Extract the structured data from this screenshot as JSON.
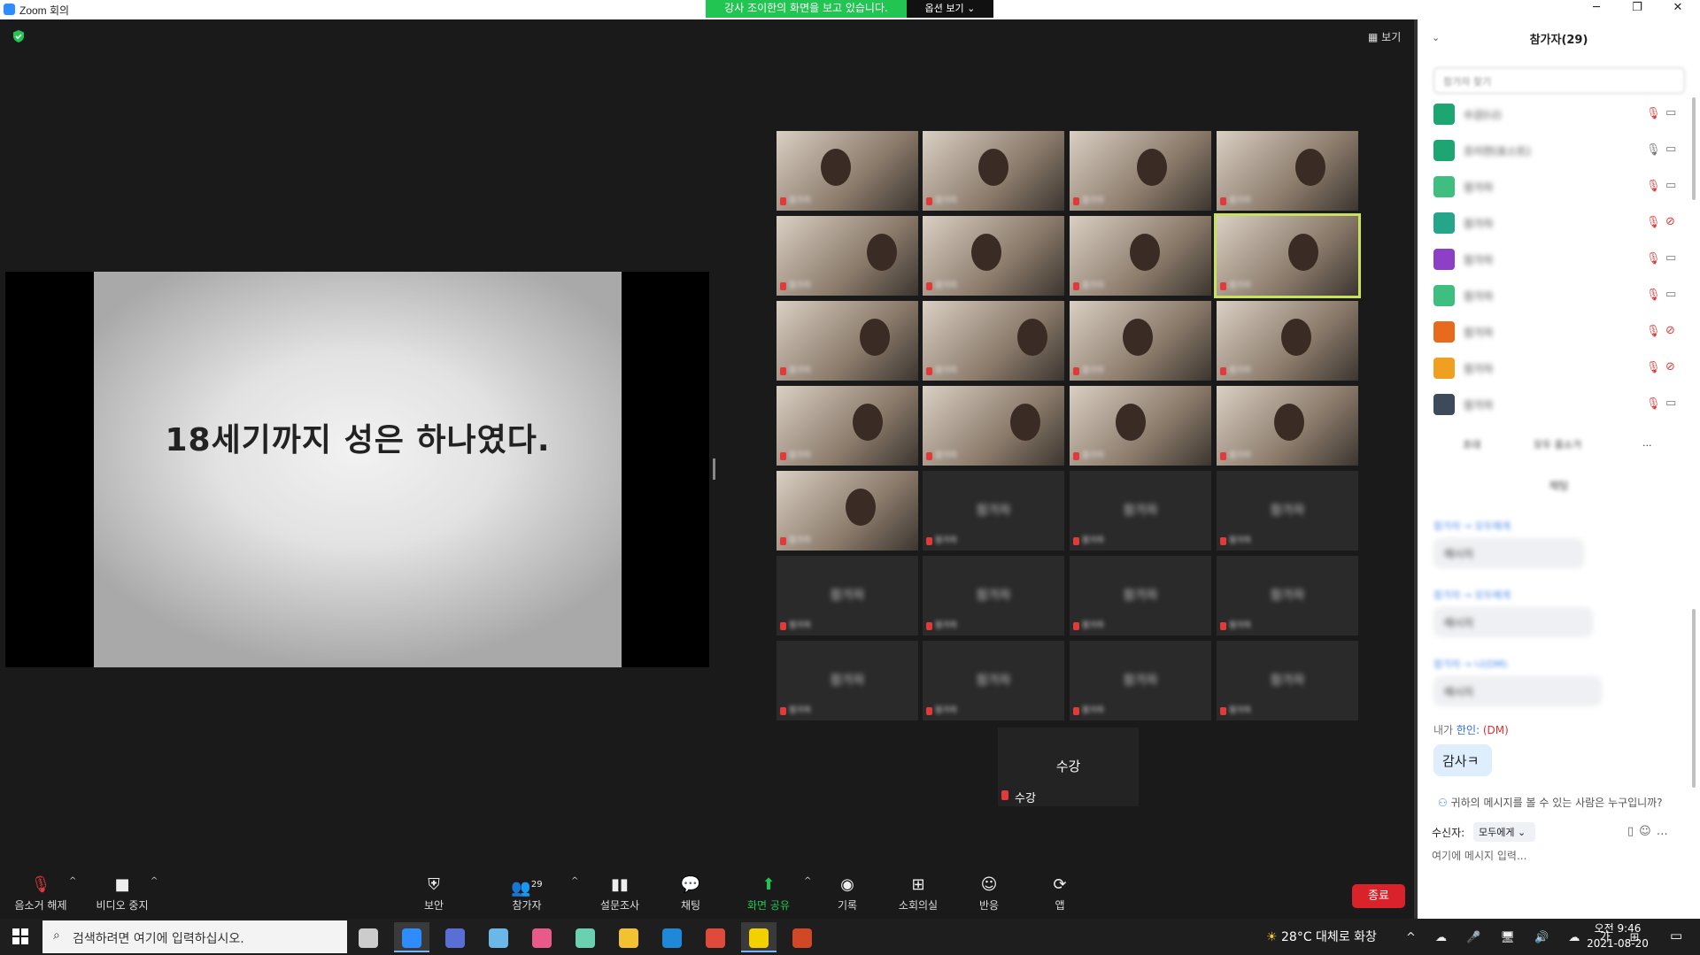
{
  "window": {
    "title": "Zoom 회의",
    "share_banner": "강사 조이한의 화면을 보고 있습니다.",
    "view_options": "옵션 보기 ⌄",
    "controls": [
      "─",
      "❐",
      "✕"
    ]
  },
  "meeting": {
    "view_label": "보기",
    "slide_text": "18세기까지 성은 하나였다.",
    "self_tile": {
      "display_name": "수강",
      "label": "수강"
    }
  },
  "toolbar": {
    "unmute": "음소거 해제",
    "stop_video": "비디오 중지",
    "security": "보안",
    "participants": "참가자",
    "participants_count": "29",
    "polls": "설문조사",
    "chat": "채팅",
    "share_screen": "화면 공유",
    "record": "기록",
    "breakout": "소회의실",
    "reactions": "반응",
    "apps": "앱",
    "end": "종료"
  },
  "panel": {
    "title": "참가자(29)",
    "search_placeholder": "참가자 찾기",
    "participants": [
      {
        "name": "수강(나)",
        "color": "#1ea672",
        "mic": "off",
        "video": "on"
      },
      {
        "name": "조이한(호스트)",
        "color": "#1ea672",
        "mic": "on",
        "video": "on"
      },
      {
        "name": "참가자",
        "color": "#3fbf7f",
        "mic": "off",
        "video": "on"
      },
      {
        "name": "참가자",
        "color": "#25a58a",
        "mic": "off",
        "video": "off"
      },
      {
        "name": "참가자",
        "color": "#8c3fc7",
        "mic": "off",
        "video": "on"
      },
      {
        "name": "참가자",
        "color": "#3fbf7f",
        "mic": "off",
        "video": "on"
      },
      {
        "name": "참가자",
        "color": "#e86a1c",
        "mic": "off",
        "video": "off"
      },
      {
        "name": "참가자",
        "color": "#f0a020",
        "mic": "off",
        "video": "off"
      },
      {
        "name": "참가자",
        "color": "#3c4a5c",
        "mic": "off",
        "video": "on"
      }
    ],
    "buttons": [
      "초대",
      "모두 음소거",
      "..."
    ],
    "chat_title": "채팅",
    "messages": [
      {
        "meta": "참가자 → 모두에게",
        "text": "메시지"
      },
      {
        "meta": "참가자 → 모두에게",
        "text": "메시지"
      },
      {
        "meta": "참가자 → 나(DM)",
        "text": "메시지"
      }
    ],
    "my_message": {
      "prefix": "내가 ",
      "to": "한인:",
      "dm": " (DM)",
      "text": "감사ㅋ"
    },
    "who_can_see": "귀하의 메시지를 볼 수 있는 사람은 누구입니까?",
    "recipient_label": "수신자:",
    "recipient_value": "모두에게 ⌄",
    "input_placeholder": "여기에 메시지 입력..."
  },
  "grid": {
    "tiles": [
      {
        "type": "video",
        "name": "참가자"
      },
      {
        "type": "video",
        "name": "참가자"
      },
      {
        "type": "video",
        "name": "참가자"
      },
      {
        "type": "video",
        "name": "참가자"
      },
      {
        "type": "video",
        "name": "참가자"
      },
      {
        "type": "video",
        "name": "참가자"
      },
      {
        "type": "video",
        "name": "참가자"
      },
      {
        "type": "video",
        "name": "참가자",
        "highlight": true
      },
      {
        "type": "video",
        "name": "참가자"
      },
      {
        "type": "video",
        "name": "참가자"
      },
      {
        "type": "video",
        "name": "참가자"
      },
      {
        "type": "video",
        "name": "참가자"
      },
      {
        "type": "video",
        "name": "참가자"
      },
      {
        "type": "video",
        "name": "참가자"
      },
      {
        "type": "video",
        "name": "참가자"
      },
      {
        "type": "video",
        "name": "참가자"
      },
      {
        "type": "video",
        "name": "참가자"
      },
      {
        "type": "name",
        "name": "참가자"
      },
      {
        "type": "name",
        "name": "참가자"
      },
      {
        "type": "name",
        "name": "참가자"
      },
      {
        "type": "name",
        "name": "참가자"
      },
      {
        "type": "name",
        "name": "참가자"
      },
      {
        "type": "name",
        "name": "참가자"
      },
      {
        "type": "name",
        "name": "참가자"
      },
      {
        "type": "name",
        "name": "참가자"
      },
      {
        "type": "name",
        "name": "참가자"
      },
      {
        "type": "name",
        "name": "참가자"
      },
      {
        "type": "name",
        "name": "참가자"
      }
    ]
  },
  "taskbar": {
    "search_placeholder": "검색하려면 여기에 입력하십시오.",
    "weather": "28°C 대체로 화창",
    "tray": "^ ☁ 🎤 🖥 🔊 ☁ 가 ⊞",
    "time": "오전 9:46",
    "date": "2021-08-20",
    "apps": [
      {
        "name": "task-view",
        "color": "#cccccc"
      },
      {
        "name": "zoom",
        "color": "#2d8cff",
        "active": true
      },
      {
        "name": "calculator",
        "color": "#5a6fd6"
      },
      {
        "name": "notepad",
        "color": "#6bb7e8"
      },
      {
        "name": "paint",
        "color": "#e85a8a"
      },
      {
        "name": "paint-brush",
        "color": "#6ad0b0"
      },
      {
        "name": "file-explorer",
        "color": "#f2c230"
      },
      {
        "name": "store",
        "color": "#1f88d8"
      },
      {
        "name": "chrome",
        "color": "#e04a3a"
      },
      {
        "name": "sticky-notes",
        "color": "#f5d000",
        "active": true
      },
      {
        "name": "powerpoint",
        "color": "#d24726"
      }
    ]
  }
}
